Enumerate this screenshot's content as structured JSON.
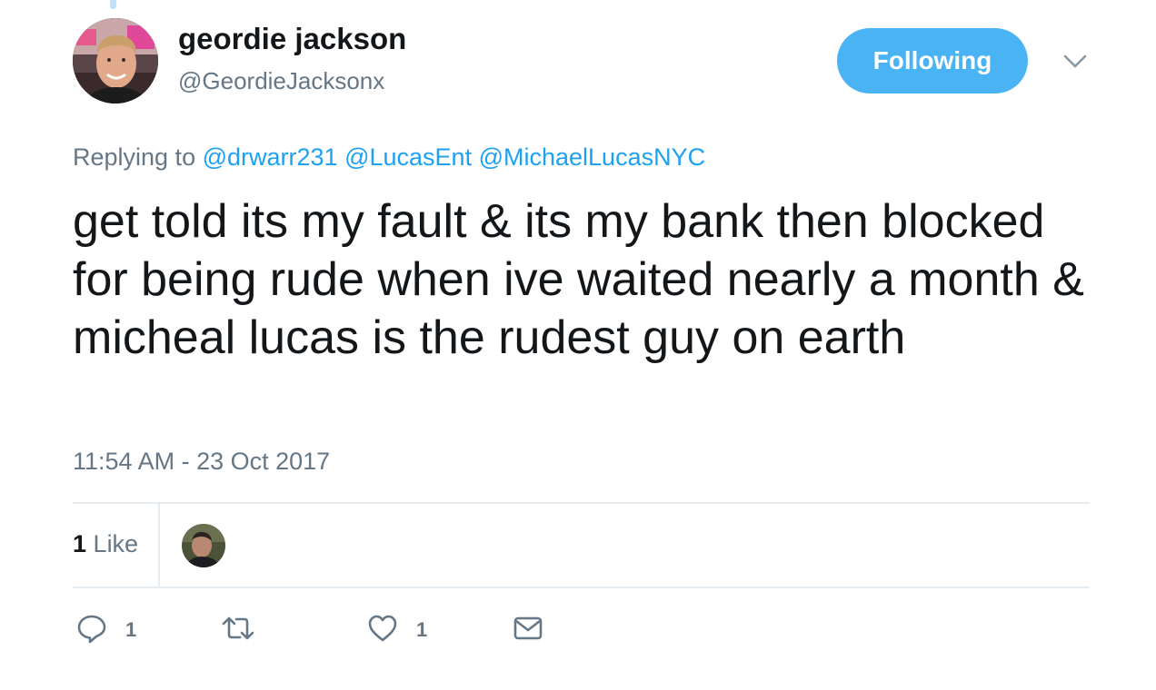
{
  "tweet": {
    "author": {
      "display_name": "geordie jackson",
      "handle": "@GeordieJacksonx"
    },
    "follow_button_label": "Following",
    "reply": {
      "prefix": "Replying to",
      "mentions": [
        "@drwarr231",
        "@LucasEnt",
        "@MichaelLucasNYC"
      ]
    },
    "text": "get told its my fault & its my bank then blocked for being rude when ive waited nearly a month & micheal lucas is the rudest guy on earth",
    "timestamp": "11:54 AM - 23 Oct 2017",
    "stats": {
      "likes_count": "1",
      "likes_label": "Like"
    },
    "actions": {
      "reply_count": "1",
      "like_count": "1"
    }
  },
  "colors": {
    "accent": "#1da1f2",
    "button_bg": "#4ab3f4",
    "muted_text": "#657786",
    "body_text": "#14171a",
    "divider": "#e6ecf0"
  },
  "icons": [
    "reply-icon",
    "retweet-icon",
    "heart-icon",
    "direct-message-icon",
    "chevron-down-icon"
  ]
}
